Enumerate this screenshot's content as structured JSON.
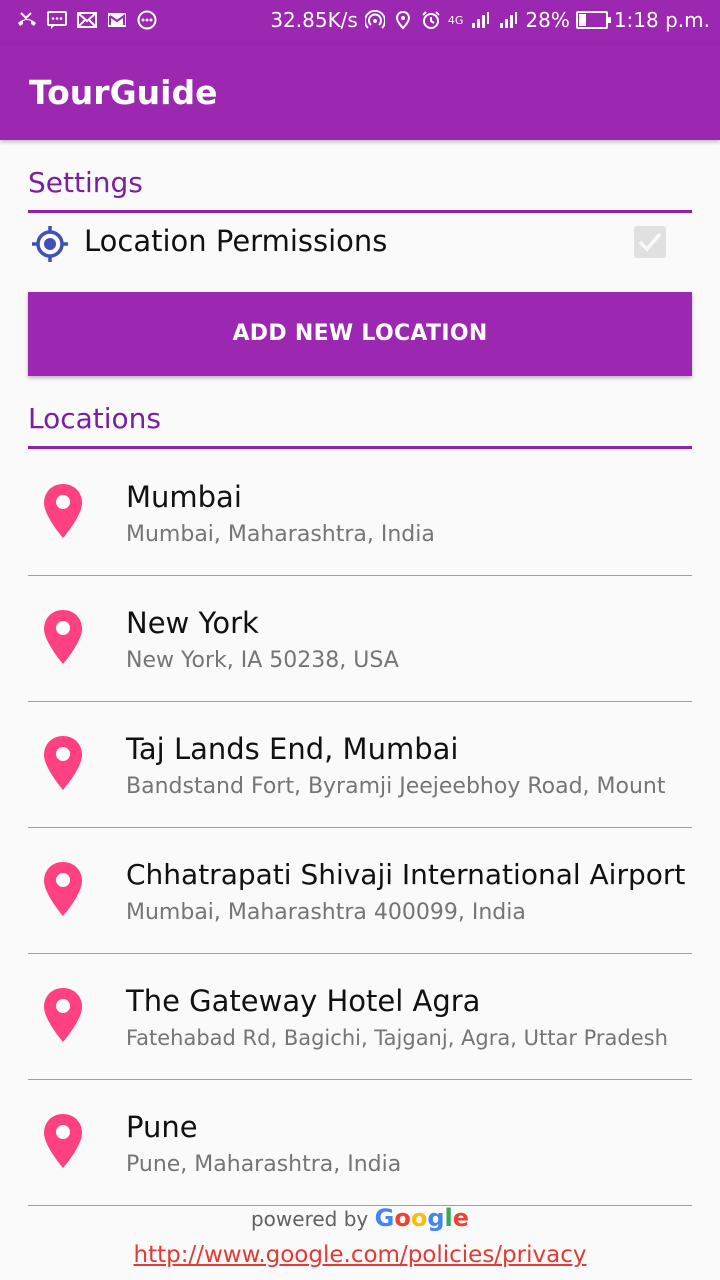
{
  "status_bar": {
    "speed": "32.85K/s",
    "network": "4G",
    "battery": "28%",
    "time": "1:18 p.m.",
    "left_icons": [
      "missed-call-icon",
      "message-icon",
      "email-icon",
      "gmail-icon",
      "more-icon"
    ],
    "right_icons": [
      "hotspot-icon",
      "location-icon",
      "alarm-icon",
      "signal-icon",
      "signal-icon",
      "battery-icon"
    ]
  },
  "app_bar": {
    "title": "TourGuide"
  },
  "settings": {
    "title": "Settings",
    "location_permission": {
      "label": "Location Permissions",
      "checked": true,
      "icon": "my-location-icon"
    }
  },
  "add_button": {
    "label": "ADD NEW LOCATION"
  },
  "locations": {
    "title": "Locations",
    "items": [
      {
        "name": "Mumbai",
        "address": "Mumbai, Maharashtra, India"
      },
      {
        "name": "New York",
        "address": "New York, IA 50238, USA"
      },
      {
        "name": "Taj Lands End, Mumbai",
        "address": "Bandstand Fort, Byramji Jeejeebhoy Road, Mount"
      },
      {
        "name": "Chhatrapati Shivaji International Airport",
        "address": "Mumbai, Maharashtra 400099, India"
      },
      {
        "name": "The Gateway Hotel Agra",
        "address": "Fatehabad Rd, Bagichi, Tajganj, Agra, Uttar Pradesh"
      },
      {
        "name": "Pune",
        "address": "Pune, Maharashtra, India"
      }
    ]
  },
  "footer": {
    "powered_by": "powered by",
    "google": "Google",
    "privacy_link": "http://www.google.com/policies/privacy"
  },
  "colors": {
    "primary": "#9c27b0",
    "accent_text": "#7b1fa2",
    "pin": "#ff4081",
    "link": "#e53935"
  }
}
